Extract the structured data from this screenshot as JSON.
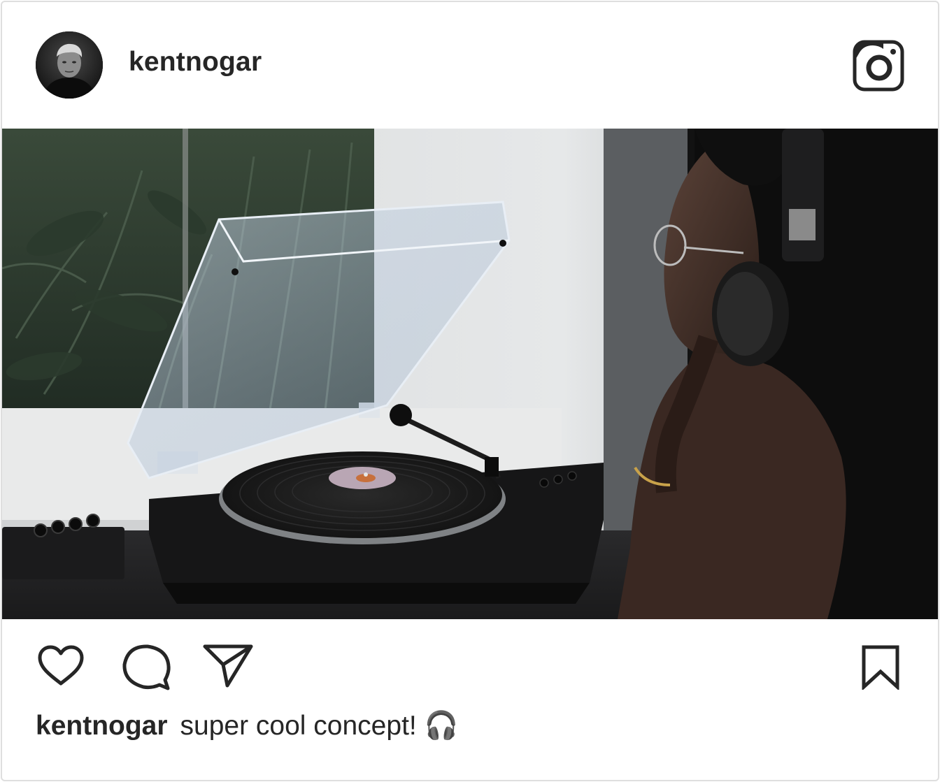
{
  "post": {
    "username": "kentnogar",
    "caption": {
      "username": "kentnogar",
      "text": "super cool concept! 🎧"
    }
  },
  "icons": {
    "header_right": "instagram-logo-icon",
    "like": "heart-icon",
    "comment": "comment-icon",
    "share": "send-icon",
    "save": "bookmark-icon"
  },
  "colors": {
    "text": "#262626",
    "border": "#dedede",
    "icon": "#262626"
  }
}
